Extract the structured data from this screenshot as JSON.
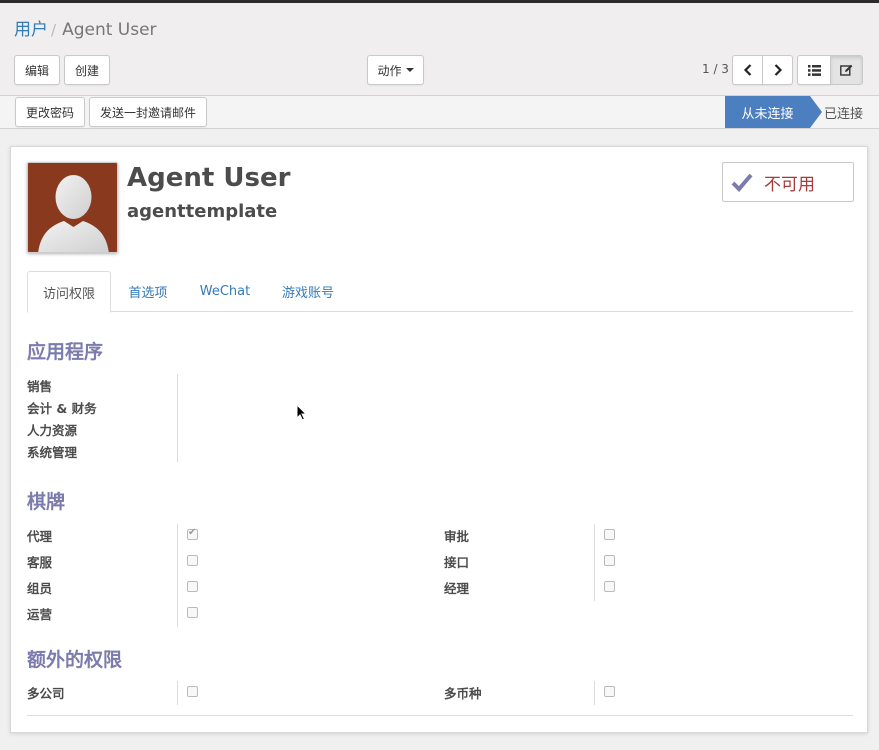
{
  "breadcrumb": {
    "parent": "用户",
    "separator": "/",
    "current": "Agent User"
  },
  "toolbar": {
    "edit": "编辑",
    "create": "创建",
    "action": "动作"
  },
  "pager": {
    "value": "1 / 3"
  },
  "statusbar": {
    "buttons": {
      "change_password": "更改密码",
      "send_invite": "发送一封邀请邮件"
    },
    "states": {
      "never_connected": "从未连接",
      "connected": "已连接"
    },
    "active_state": "never_connected"
  },
  "user": {
    "name": "Agent User",
    "login": "agenttemplate",
    "active_toggle": "不可用",
    "avatar_bg": "#893a1e"
  },
  "tabs": [
    "访问权限",
    "首选项",
    "WeChat",
    "游戏账号"
  ],
  "sections": {
    "applications": {
      "title": "应用程序",
      "items": [
        "销售",
        "会计 & 财务",
        "人力资源",
        "系统管理"
      ]
    },
    "chess": {
      "title": "棋牌",
      "left": [
        {
          "label": "代理",
          "checked": true
        },
        {
          "label": "客服",
          "checked": false
        },
        {
          "label": "组员",
          "checked": false
        },
        {
          "label": "运营",
          "checked": false
        }
      ],
      "right": [
        {
          "label": "审批",
          "checked": false
        },
        {
          "label": "接口",
          "checked": false
        },
        {
          "label": "经理",
          "checked": false
        }
      ]
    },
    "extra": {
      "title": "额外的权限",
      "left": [
        {
          "label": "多公司",
          "checked": false
        }
      ],
      "right": [
        {
          "label": "多币种",
          "checked": false
        }
      ]
    }
  },
  "colors": {
    "primary": "#4c7fbf",
    "section_title": "#7c7bad",
    "link": "#337ab7",
    "inactive_text": "#a53c3c"
  }
}
